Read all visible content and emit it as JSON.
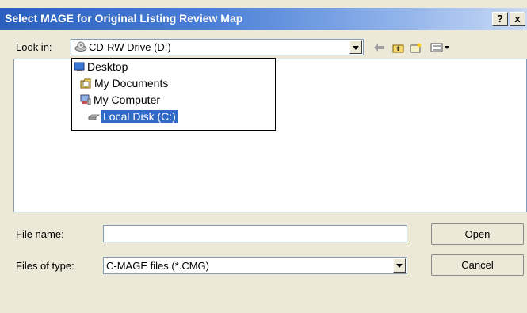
{
  "window": {
    "title": "Select MAGE for Original Listing Review Map",
    "help_label": "?",
    "close_label": "x"
  },
  "look_in": {
    "label": "Look in:",
    "value": "CD-RW Drive (D:)"
  },
  "toolbar": {
    "back_icon": "back-arrow-icon",
    "up_icon": "up-folder-icon",
    "new_folder_icon": "new-folder-icon",
    "view_menu_icon": "view-menu-icon"
  },
  "location_dropdown": {
    "items": [
      {
        "label": "Desktop",
        "icon": "desktop-icon"
      },
      {
        "label": "My Documents",
        "icon": "documents-folder-icon"
      },
      {
        "label": "My Computer",
        "icon": "computer-icon"
      },
      {
        "label": "Local Disk (C:)",
        "icon": "disk-icon",
        "selected": true
      }
    ]
  },
  "file_name": {
    "label": "File name:",
    "value": ""
  },
  "files_of_type": {
    "label": "Files of type:",
    "value": "C-MAGE files (*.CMG)"
  },
  "buttons": {
    "open_label": "Open",
    "cancel_label": "Cancel"
  },
  "colors": {
    "title_gradient_start": "#2a5fbe",
    "selection": "#316ac5",
    "dialog_bg": "#ece9d8"
  }
}
